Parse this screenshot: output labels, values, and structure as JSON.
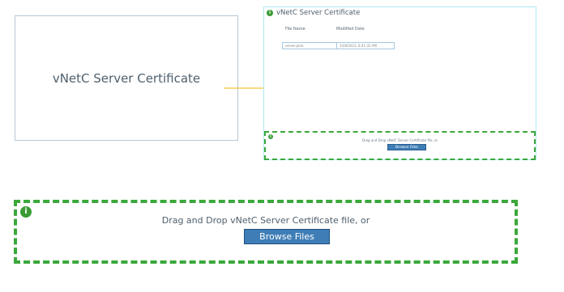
{
  "panel": {
    "title": "vNetC Server Certificate"
  },
  "thumbnail": {
    "title": "vNetC Server Certificate",
    "table": {
      "headers": [
        "File Name",
        "Modified Date"
      ],
      "rows": [
        [
          "server.pem",
          "1/28/2023, 8:41:32 AM"
        ]
      ]
    },
    "drop_text": "Drag and Drop vNetC Server Certificate file, or",
    "browse_label": "Browse Files"
  },
  "dropzone": {
    "text": "Drag and Drop vNetC Server Certificate file, or",
    "browse_label": "Browse Files"
  },
  "colors": {
    "accent": "#3a9b35",
    "button": "#3f7db6",
    "arrow": "#f0b400",
    "border_cyan": "#aee8f0"
  },
  "icons": {
    "info": "info-icon",
    "arrow": "arrow-right-icon"
  }
}
